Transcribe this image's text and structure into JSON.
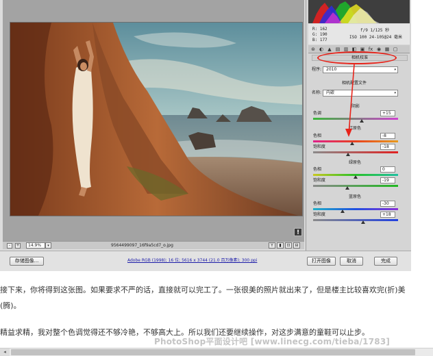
{
  "camera_raw": {
    "status_bar": {
      "zoom_value": "14.9%",
      "file_name": "9564499097_16f9a5cd7_o.jpg",
      "minus_symbol": "-",
      "plus_symbol": "+",
      "dropdown_arrow": "▾",
      "view_icons": [
        "Y",
        "▮",
        "⊡",
        "⊟"
      ]
    },
    "alert_symbol": "!",
    "bottom_bar": {
      "save_label": "存储图像...",
      "workflow_text": "Adobe RGB (1998); 16 位; 5616 x 3744 (21.0 百万像素); 300 ppi",
      "open_label": "打开图像",
      "cancel_label": "取消",
      "done_label": "完成"
    },
    "info": {
      "r": "R:  162",
      "g": "G:  190",
      "b": "B:  177",
      "exif_line1": "f/9   1/125 秒",
      "exif_line2": "ISO 100   24-105@24 毫米"
    },
    "tool_tabs": [
      "⊛",
      "◐",
      "▲",
      "▤",
      "▥",
      "◧",
      "▣",
      "fx",
      "◉",
      "▦",
      "▢"
    ],
    "panel": {
      "title": "相机校准",
      "process_label": "程序:",
      "process_value": "2010",
      "profile_heading": "相机配置文件",
      "name_label": "名称:",
      "name_value": "内嵌",
      "shadows_heading": "阴影",
      "tint_label": "色调",
      "tint_value": "+15",
      "red_heading": "红原色",
      "red_hue_label": "色相",
      "red_hue_value": "-8",
      "red_sat_label": "饱和度",
      "red_sat_value": "-18",
      "green_heading": "绿原色",
      "green_hue_label": "色相",
      "green_hue_value": "0",
      "green_sat_label": "饱和度",
      "green_sat_value": "-19",
      "blue_heading": "蓝原色",
      "blue_hue_label": "色相",
      "blue_hue_value": "-30",
      "blue_sat_label": "饱和度",
      "blue_sat_value": "+18",
      "select_arrow": "▾"
    },
    "slider_levels": {
      "tint": 15,
      "red_hue": -8,
      "red_sat": -18,
      "green_hue": 0,
      "green_sat": -19,
      "blue_hue": -30,
      "blue_sat": 18
    },
    "colors": {
      "annotation_red": "#e8231a",
      "window_bg": "#dcdcdc",
      "preview_bg": "#a3a3a3"
    }
  },
  "article": {
    "paragraph1": "接下来，你将得到这张图。如果要求不严的话，直接就可以完工了。一张很美的照片就出来了，但是楼主比较喜欢完(折)美(腾)。",
    "paragraph2": "精益求精，我对整个色调觉得还不够冷艳，不够高大上。所以我们还要继续操作，对这步满意的童鞋可以止步。",
    "watermark": "PhotoShop平面设计吧  [www.linecg.com/tieba/1783]"
  },
  "scrollbar": {
    "left_arrow": "◂"
  }
}
